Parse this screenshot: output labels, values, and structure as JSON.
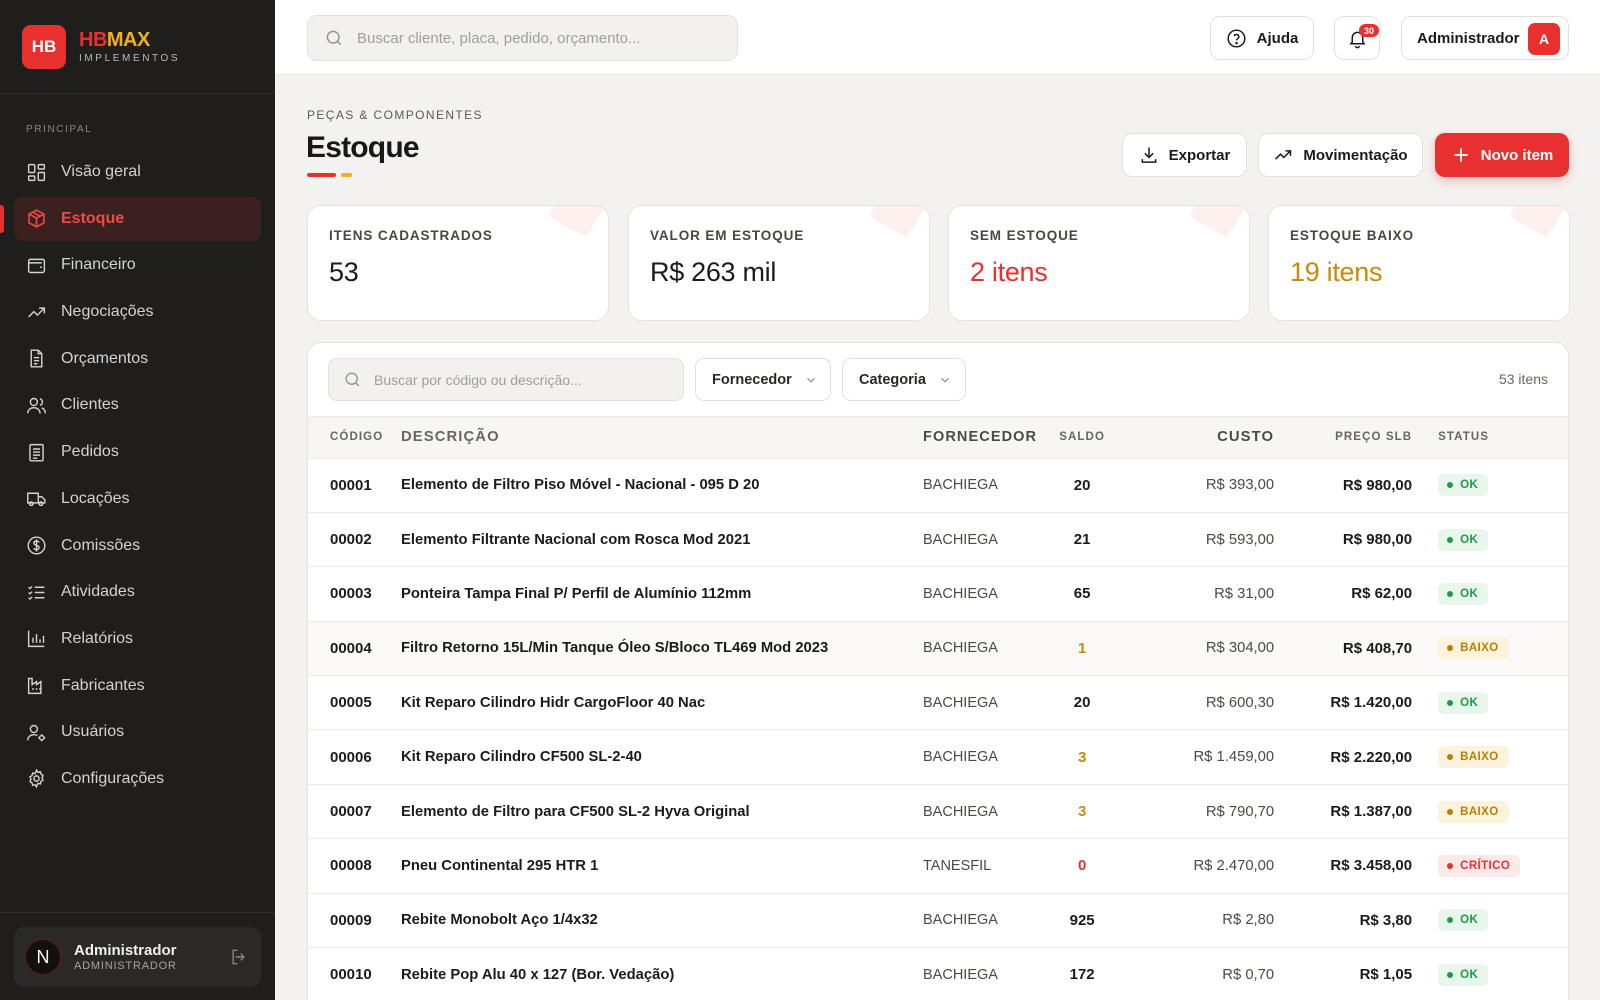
{
  "brand": {
    "badge": "HB",
    "name_a": "HB",
    "name_b": "MAX",
    "subtitle": "IMPLEMENTOS"
  },
  "sidebar": {
    "section": "PRINCIPAL",
    "items": [
      {
        "label": "Visão geral",
        "icon": "dashboard-icon"
      },
      {
        "label": "Estoque",
        "icon": "box-icon",
        "active": true
      },
      {
        "label": "Financeiro",
        "icon": "wallet-icon"
      },
      {
        "label": "Negociações",
        "icon": "trend-icon"
      },
      {
        "label": "Orçamentos",
        "icon": "document-icon"
      },
      {
        "label": "Clientes",
        "icon": "users-icon"
      },
      {
        "label": "Pedidos",
        "icon": "clipboard-icon"
      },
      {
        "label": "Locações",
        "icon": "truck-icon"
      },
      {
        "label": "Comissões",
        "icon": "dollar-icon"
      },
      {
        "label": "Atividades",
        "icon": "checklist-icon"
      },
      {
        "label": "Relatórios",
        "icon": "bar-chart-icon"
      },
      {
        "label": "Fabricantes",
        "icon": "factory-icon"
      },
      {
        "label": "Usuários",
        "icon": "user-settings-icon"
      },
      {
        "label": "Configurações",
        "icon": "gear-icon"
      }
    ],
    "user": {
      "initial": "N",
      "name": "Administrador",
      "role": "ADMINISTRADOR"
    }
  },
  "topbar": {
    "search_placeholder": "Buscar cliente, placa, pedido, orçamento...",
    "help_label": "Ajuda",
    "notifications_count": "30",
    "account_name": "Administrador",
    "account_initial": "A"
  },
  "header": {
    "breadcrumb": "PEÇAS & COMPONENTES",
    "title": "Estoque",
    "export_label": "Exportar",
    "movement_label": "Movimentação",
    "new_item_label": "Novo item"
  },
  "kpis": [
    {
      "label": "ITENS CADASTRADOS",
      "value": "53"
    },
    {
      "label": "VALOR EM ESTOQUE",
      "value": "R$ 263 mil"
    },
    {
      "label": "SEM ESTOQUE",
      "value": "2 itens"
    },
    {
      "label": "ESTOQUE BAIXO",
      "value": "19 itens"
    }
  ],
  "filters": {
    "search_placeholder": "Buscar por código ou descrição...",
    "supplier_label": "Fornecedor",
    "category_label": "Categoria",
    "count_label": "53 itens"
  },
  "table": {
    "columns": [
      "CÓDIGO",
      "DESCRIÇÃO",
      "FORNECEDOR",
      "SALDO",
      "CUSTO",
      "PREÇO SLB",
      "STATUS"
    ],
    "rows": [
      {
        "code": "00001",
        "desc": "Elemento de Filtro Piso Móvel - Nacional - 095 D 20",
        "supplier": "BACHIEGA",
        "balance": "20",
        "cost": "R$ 393,00",
        "price": "R$ 980,00",
        "status": "OK",
        "level": "ok"
      },
      {
        "code": "00002",
        "desc": "Elemento Filtrante Nacional com Rosca Mod 2021",
        "supplier": "BACHIEGA",
        "balance": "21",
        "cost": "R$ 593,00",
        "price": "R$ 980,00",
        "status": "OK",
        "level": "ok"
      },
      {
        "code": "00003",
        "desc": "Ponteira Tampa Final P/ Perfil de Alumínio 112mm",
        "supplier": "BACHIEGA",
        "balance": "65",
        "cost": "R$ 31,00",
        "price": "R$ 62,00",
        "status": "OK",
        "level": "ok"
      },
      {
        "code": "00004",
        "desc": "Filtro Retorno 15L/Min Tanque Óleo S/Bloco TL469 Mod 2023",
        "supplier": "BACHIEGA",
        "balance": "1",
        "cost": "R$ 304,00",
        "price": "R$ 408,70",
        "status": "BAIXO",
        "level": "baixo"
      },
      {
        "code": "00005",
        "desc": "Kit Reparo Cilindro Hidr CargoFloor 40 Nac",
        "supplier": "BACHIEGA",
        "balance": "20",
        "cost": "R$ 600,30",
        "price": "R$ 1.420,00",
        "status": "OK",
        "level": "ok"
      },
      {
        "code": "00006",
        "desc": "Kit Reparo Cilindro CF500 SL-2-40",
        "supplier": "BACHIEGA",
        "balance": "3",
        "cost": "R$ 1.459,00",
        "price": "R$ 2.220,00",
        "status": "BAIXO",
        "level": "baixo"
      },
      {
        "code": "00007",
        "desc": "Elemento de Filtro para CF500 SL-2 Hyva Original",
        "supplier": "BACHIEGA",
        "balance": "3",
        "cost": "R$ 790,70",
        "price": "R$ 1.387,00",
        "status": "BAIXO",
        "level": "baixo"
      },
      {
        "code": "00008",
        "desc": "Pneu Continental 295 HTR 1",
        "supplier": "TANESFIL",
        "balance": "0",
        "cost": "R$ 2.470,00",
        "price": "R$ 3.458,00",
        "status": "CRÍTICO",
        "level": "critico"
      },
      {
        "code": "00009",
        "desc": "Rebite Monobolt Aço 1/4x32",
        "supplier": "BACHIEGA",
        "balance": "925",
        "cost": "R$ 2,80",
        "price": "R$ 3,80",
        "status": "OK",
        "level": "ok"
      },
      {
        "code": "00010",
        "desc": "Rebite Pop Alu 40 x 127 (Bor. Vedação)",
        "supplier": "BACHIEGA",
        "balance": "172",
        "cost": "R$ 0,70",
        "price": "R$ 1,05",
        "status": "OK",
        "level": "ok"
      }
    ]
  },
  "colors": {
    "accent": "#e8302f",
    "amber": "#c78a0a",
    "ok": "#1f9a4a",
    "sidebar_bg": "#1f1e1d"
  }
}
